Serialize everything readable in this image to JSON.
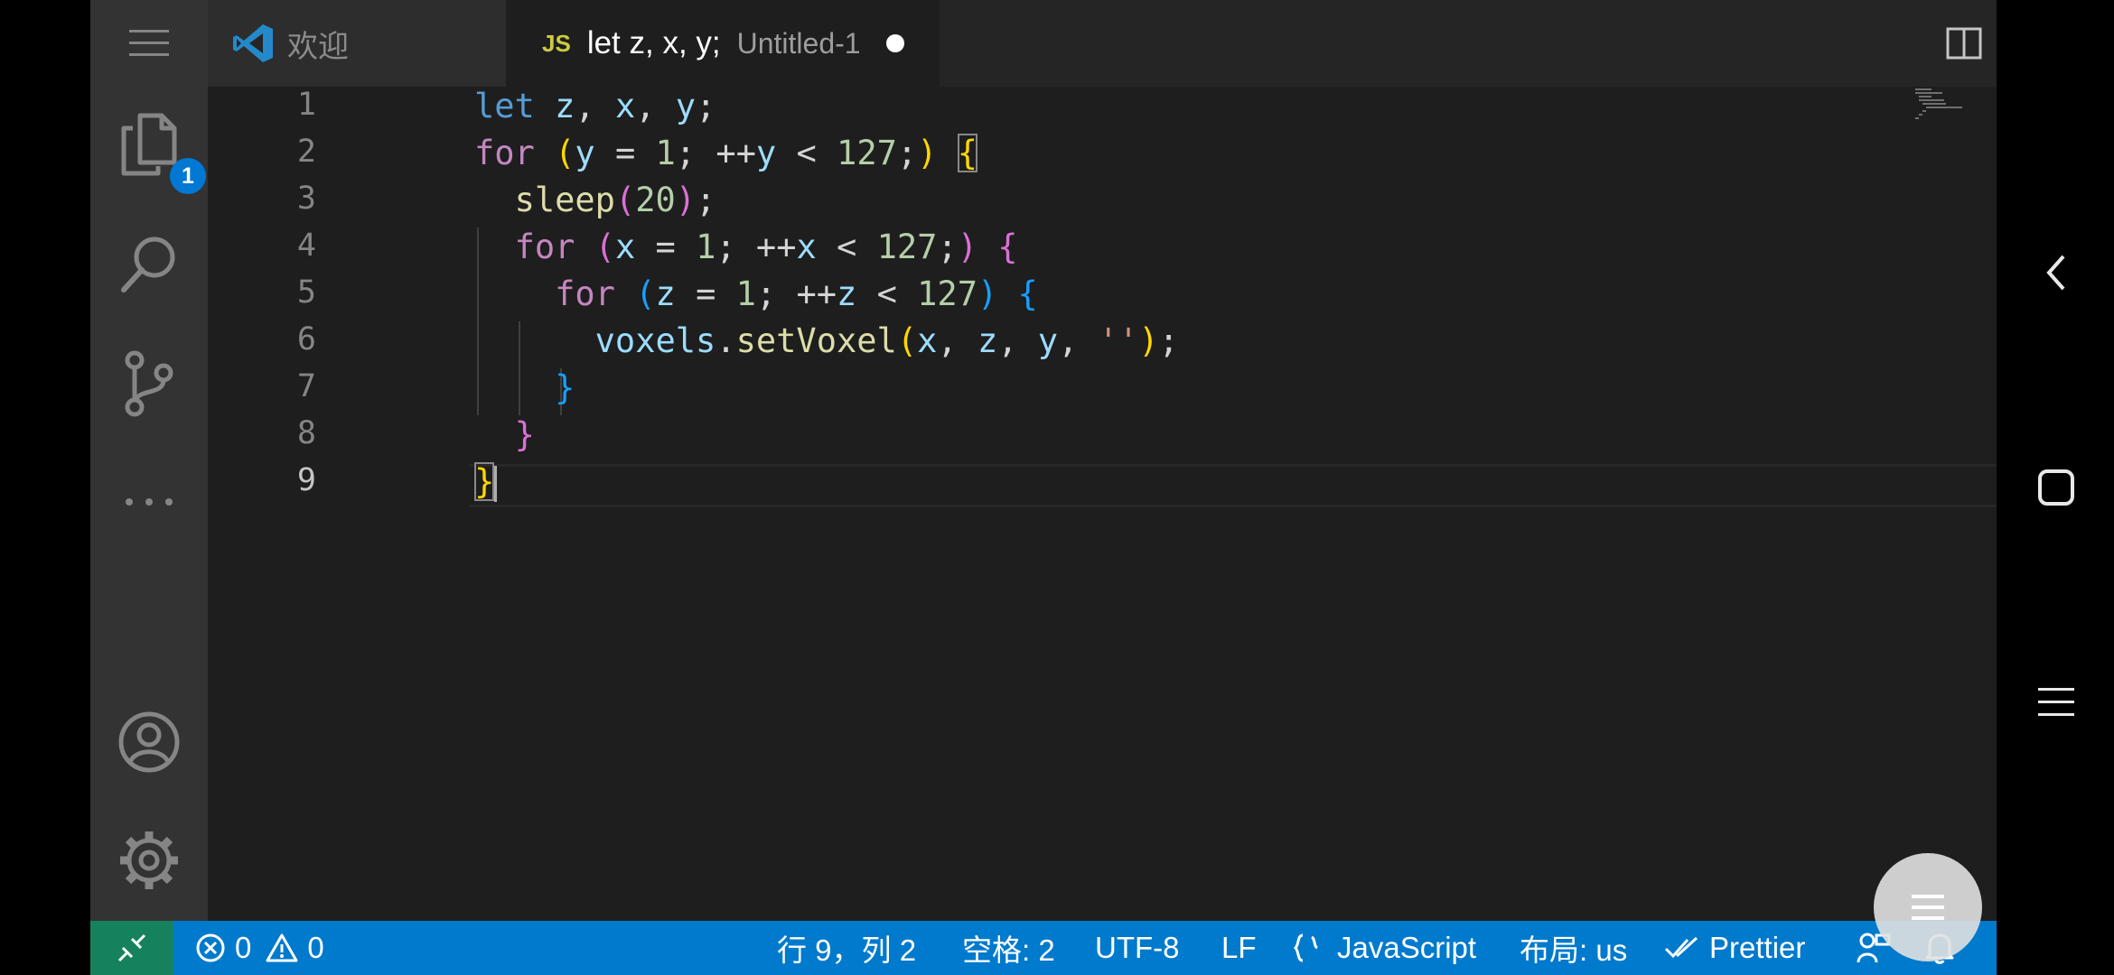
{
  "tabs": {
    "welcome": {
      "label": "欢迎",
      "icon": "vscode-logo-icon"
    },
    "untitled": {
      "lang_badge": "JS",
      "label": "let z, x, y;",
      "description": "Untitled-1",
      "dirty": true
    }
  },
  "activity_bar": {
    "items": [
      "menu-icon",
      "files-icon",
      "search-icon",
      "source-control-icon",
      "more-icon",
      "account-icon",
      "settings-gear-icon"
    ],
    "explorer_badge": "1"
  },
  "editor": {
    "line_numbers": [
      "1",
      "2",
      "3",
      "4",
      "5",
      "6",
      "7",
      "8",
      "9"
    ],
    "active_line": "9",
    "lines": [
      "let z, x, y;",
      "for (y = 1; ++y < 127;) {",
      "  sleep(20);",
      "  for (x = 1; ++x < 127;) {",
      "    for (z = 1; ++z < 127) {",
      "      voxels.setVoxel(x, z, y, '');",
      "    }",
      "  }",
      "}"
    ]
  },
  "status_bar": {
    "errors": "0",
    "warnings": "0",
    "cursor_position": "行 9，列 2",
    "indentation": "空格: 2",
    "encoding": "UTF-8",
    "eol": "LF",
    "language": "JavaScript",
    "keyboard_layout": "布局: us",
    "formatter": "Prettier"
  },
  "colors": {
    "status_bar": "#007acc",
    "remote_indicator": "#16825d",
    "activity_bar": "#333333",
    "editor_bg": "#1e1e1e",
    "badge": "#0078d4"
  },
  "android_nav": [
    "back-icon",
    "home-icon",
    "menu-icon"
  ]
}
